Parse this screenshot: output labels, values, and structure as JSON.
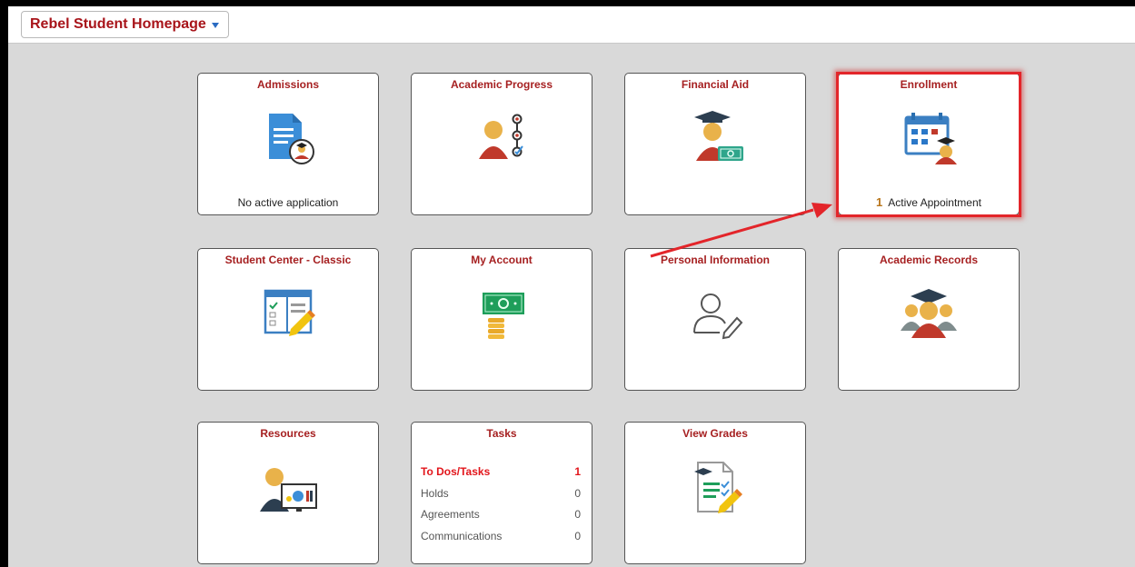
{
  "header": {
    "homepage_title": "Rebel Student Homepage"
  },
  "tiles": {
    "admissions": {
      "title": "Admissions",
      "footer": "No active application"
    },
    "academic_progress": {
      "title": "Academic Progress"
    },
    "financial_aid": {
      "title": "Financial Aid"
    },
    "enrollment": {
      "title": "Enrollment",
      "count": "1",
      "footer": "Active Appointment"
    },
    "student_center": {
      "title": "Student Center - Classic"
    },
    "my_account": {
      "title": "My Account"
    },
    "personal_information": {
      "title": "Personal Information"
    },
    "academic_records": {
      "title": "Academic Records"
    },
    "resources": {
      "title": "Resources"
    },
    "tasks": {
      "title": "Tasks",
      "items": [
        {
          "label": "To Dos/Tasks",
          "count": "1"
        },
        {
          "label": "Holds",
          "count": "0"
        },
        {
          "label": "Agreements",
          "count": "0"
        },
        {
          "label": "Communications",
          "count": "0"
        }
      ]
    },
    "view_grades": {
      "title": "View Grades"
    }
  },
  "colors": {
    "accent": "#a62021",
    "highlight": "#e3252a",
    "count": "#b8751a"
  }
}
